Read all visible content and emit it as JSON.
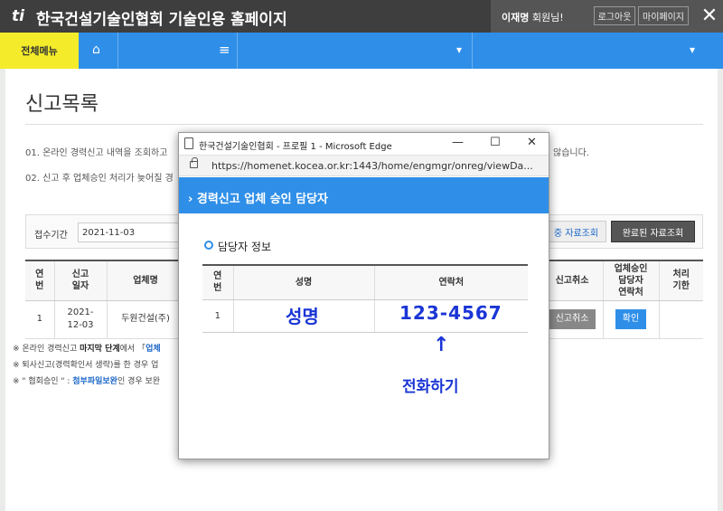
{
  "header": {
    "logo_text": "ti",
    "site_title": "한국건설기술인협회 기술인용 홈페이지",
    "user_name": "이재명",
    "user_suffix": " 회원님!",
    "logout_label": "로그아웃",
    "mypage_label": "마이페이지",
    "close_glyph": "✕"
  },
  "nav": {
    "all_menu_label": "전체메뉴",
    "home_glyph": "⌂",
    "menu_glyph": "≡",
    "dropdown_glyph": "▾"
  },
  "page": {
    "title": "신고목록",
    "notes": [
      "01. 온라인 경력신고 내역을 조회하고",
      "02. 신고 후 업체승인 처리가 늦어질 경"
    ],
    "note_tail": "않습니다."
  },
  "search": {
    "period_label": "접수기간",
    "start_date": "2021-11-03",
    "inprogress_button": "중 자료조회",
    "completed_button": "완료된 자료조회"
  },
  "table": {
    "headers": [
      "연\n번",
      "신고\n일자",
      "업체명",
      "신고취소",
      "업체승인\n담당자\n연락처",
      "처리\n기한"
    ],
    "row": {
      "no": "1",
      "date": "2021-\n12-03",
      "company": "두원건설(주)",
      "cancel_label": "신고취소",
      "confirm_label": "확인",
      "deadline": ""
    }
  },
  "footnotes": [
    {
      "prefix": "※  온라인 경력신고 ",
      "bold": "마지막 단계",
      "mid": "에서 「",
      "link": "업체",
      "suffix": ""
    },
    {
      "prefix": "※  퇴사신고(경력확인서 생략)를 한 경우 업",
      "bold": "",
      "mid": "",
      "link": "",
      "suffix": ""
    },
    {
      "prefix": "※  \" 협회승인 \" : ",
      "bold": "",
      "mid": "",
      "link": "첨부파일보완",
      "suffix": "인 경우 보완"
    }
  ],
  "popup": {
    "window_title": "한국건설기술인협회 - 프로필 1 - Microsoft Edge",
    "url": "https://homenet.kocea.or.kr:1443/home/engmgr/onreg/viewDa...",
    "minimize_glyph": "—",
    "maximize_glyph": "☐",
    "close_glyph": "✕",
    "header": "› 경력신고 업체 승인 담당자",
    "section_label": "담당자 정보",
    "table_headers": [
      "연\n번",
      "성명",
      "연락처"
    ],
    "row_no": "1",
    "name": "성명",
    "phone": "123-4567",
    "arrow": "↑",
    "call_note": "전화하기"
  }
}
